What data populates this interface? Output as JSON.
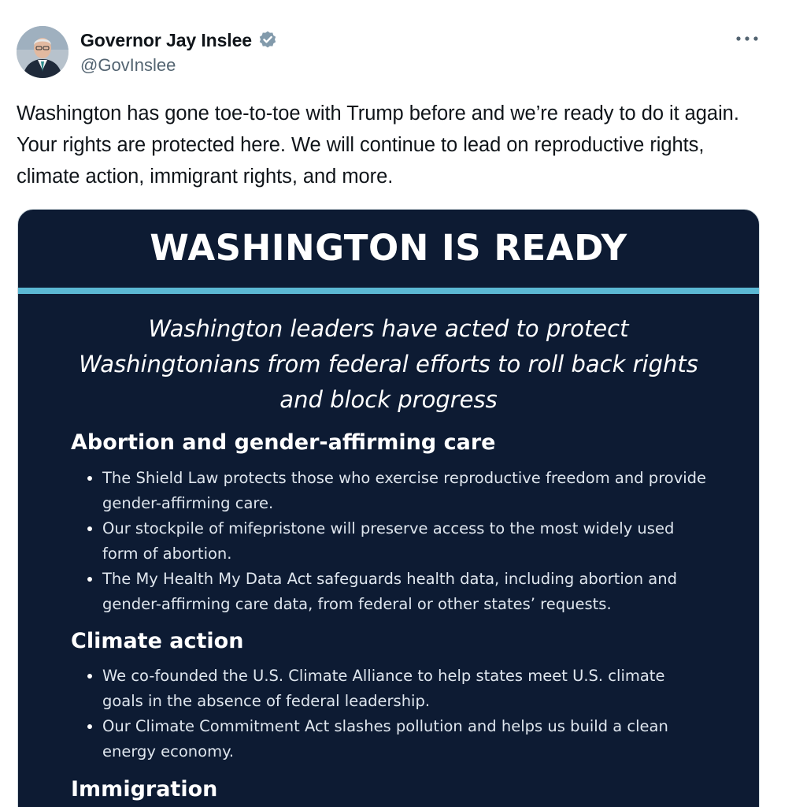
{
  "author": {
    "name": "Governor Jay Inslee",
    "handle": "@GovInslee"
  },
  "icons": {
    "verified": "verified-badge-icon",
    "more": "more-options-icon"
  },
  "colors": {
    "card_background": "#0d1b33",
    "card_rule": "#5bb8d4",
    "handle_text": "#536471",
    "verified_badge": "#829aab"
  },
  "tweet": {
    "text": "Washington has gone toe-to-toe with Trump before and we’re ready to do it again. Your rights are protected here. We will continue to lead on reproductive rights, climate action, immigrant rights, and more."
  },
  "card": {
    "title": "WASHINGTON IS READY",
    "subtitle": "Washington leaders have acted to protect Washingtonians from federal efforts to roll back rights and block progress",
    "sections": [
      {
        "heading": "Abortion and gender-affirming care",
        "bullets": [
          "The Shield Law protects those who exercise reproductive freedom and provide gender-affirming care.",
          "Our stockpile of mifepristone will preserve access to the most widely used form of abortion.",
          "The My Health My Data Act safeguards health data, including abortion and gender-affirming care data, from federal or other states’ requests."
        ]
      },
      {
        "heading": "Climate action",
        "bullets": [
          "We co-founded the U.S. Climate Alliance to help states meet U.S. climate goals in the absence of federal leadership.",
          "Our Climate Commitment Act slashes pollution and helps us build a clean energy economy."
        ]
      },
      {
        "heading": "Immigration",
        "bullets": []
      }
    ]
  }
}
